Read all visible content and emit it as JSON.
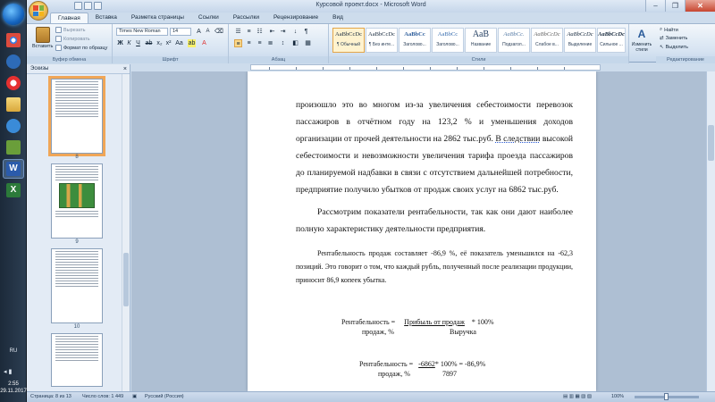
{
  "window": {
    "title": "Курсовой проект.docx - Microsoft Word"
  },
  "tabs": [
    "Главная",
    "Вставка",
    "Разметка страницы",
    "Ссылки",
    "Рассылки",
    "Рецензирование",
    "Вид"
  ],
  "ribbon": {
    "clipboard": {
      "paste": "Вставить",
      "cut": "Вырезать",
      "copy": "Копировать",
      "format_painter": "Формат по образцу",
      "label": "Буфер обмена"
    },
    "font": {
      "name": "Times New Roman",
      "size": "14",
      "label": "Шрифт"
    },
    "paragraph": {
      "label": "Абзац"
    },
    "styles": {
      "label": "Стили",
      "items": [
        {
          "preview": "AaBbCcDc",
          "name": "¶ Обычный"
        },
        {
          "preview": "AaBbCcDc",
          "name": "¶ Без инте..."
        },
        {
          "preview": "AaBbCc",
          "name": "Заголово..."
        },
        {
          "preview": "AaBbCc",
          "name": "Заголово..."
        },
        {
          "preview": "АаВ",
          "name": "Название"
        },
        {
          "preview": "AaBbCc.",
          "name": "Подзагол..."
        },
        {
          "preview": "AaBbCcDc",
          "name": "Слабое в..."
        },
        {
          "preview": "AaBbCcDc",
          "name": "Выделение"
        },
        {
          "preview": "AaBbCcDc",
          "name": "Сильное ..."
        }
      ],
      "change_styles": "Изменить стили"
    },
    "editing": {
      "find": "Найти",
      "replace": "Заменить",
      "select": "Выделить",
      "label": "Редактирование"
    }
  },
  "thumbnails": {
    "header": "Эскизы",
    "pages": [
      "8",
      "9",
      "10"
    ]
  },
  "document": {
    "para1": "произошло это во многом из-за увеличения себестоимости перевозок пассажиров в отчётном году на 123,2 % и уменьшения доходов организации от прочей деятельности на 2862 тыс.руб.",
    "para1_b": "В следствии",
    "para1_c": " высокой себестоимости и невозможности увеличения тарифа проезда пассажиров до планируемой надбавки в связи с отсутствием дальнейшей потребности, предприятие получило убытков от продаж своих услуг на 6862 тыс.руб.",
    "para2": "Рассмотрим показатели рентабельности, так как они дают наиболее полную характеристику деятельности предприятия.",
    "para3": "Рентабельность продаж составляет -86,9 %, её показатель уменьшился на -62,3 позиций. Это говорит о том, что каждый рубль, полученный после реализации продукции, приносит 86,9 копеек убытка.",
    "formula1": {
      "left_top": "Рентабельность  =",
      "left_bottom": "продаж, %",
      "numerator": "Прибыль от продаж",
      "multiplier": "*  100%",
      "denominator": "Выручка"
    },
    "formula2": {
      "left_top": "Рентабельность  =",
      "left_bottom": "продаж, %",
      "numerator": "-6862",
      "rest": "*  100% = -86,9%",
      "denominator": "7897"
    }
  },
  "statusbar": {
    "page": "Страница: 8 из 13",
    "words": "Число слов: 1 449",
    "language": "Русский (Россия)",
    "zoom": "100%"
  },
  "taskbar": {
    "lang": "RU",
    "time": "2:55",
    "date": "29.11.2017"
  }
}
